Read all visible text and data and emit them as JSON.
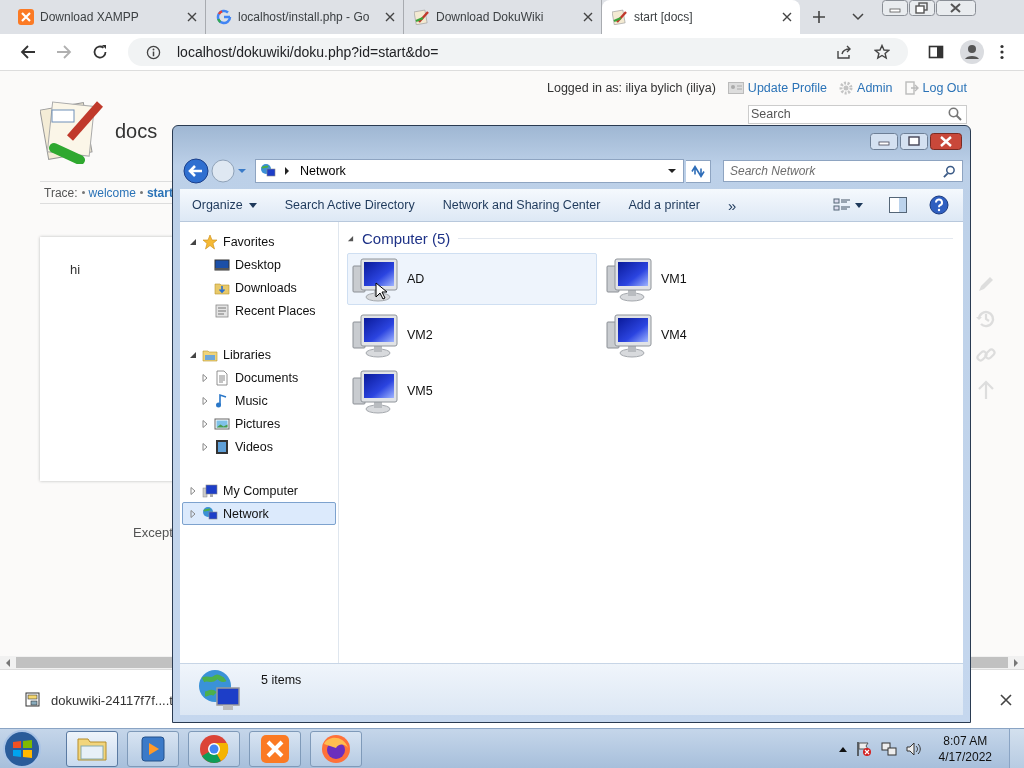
{
  "browser": {
    "tabs": [
      {
        "title": "Download XAMPP",
        "selected": false
      },
      {
        "title": "localhost/install.php - Go",
        "selected": false
      },
      {
        "title": "Download DokuWiki",
        "selected": false
      },
      {
        "title": "start [docs]",
        "selected": true
      }
    ],
    "address": "localhost/dokuwiki/doku.php?id=start&do="
  },
  "wiki": {
    "user": "Logged in as: iliya bylich (iliya)",
    "user_links": [
      "Update Profile",
      "Admin",
      "Log Out"
    ],
    "search_placeholder": "Search",
    "title": "docs",
    "trace_label": "Trace:",
    "trace": [
      "welcome",
      "start"
    ],
    "content": "hi",
    "footer": "Except"
  },
  "download": {
    "file": "dokuwiki-24117f7f....t"
  },
  "explorer": {
    "address": "Network",
    "search_placeholder": "Search Network",
    "toolbar": [
      {
        "label": "Organize",
        "menu": true
      },
      {
        "label": "Search Active Directory",
        "menu": false
      },
      {
        "label": "Network and Sharing Center",
        "menu": false
      },
      {
        "label": "Add a printer",
        "menu": false
      }
    ],
    "more": "»",
    "nav": [
      {
        "label": "Favorites",
        "expanded": true,
        "selected": false,
        "children": [
          {
            "label": "Desktop",
            "selected": false
          },
          {
            "label": "Downloads",
            "selected": false
          },
          {
            "label": "Recent Places",
            "selected": false
          }
        ]
      },
      {
        "label": "Libraries",
        "expanded": true,
        "selected": false,
        "children": [
          {
            "label": "Documents",
            "expanded": false,
            "selected": false
          },
          {
            "label": "Music",
            "expanded": false,
            "selected": false
          },
          {
            "label": "Pictures",
            "expanded": false,
            "selected": false
          },
          {
            "label": "Videos",
            "expanded": false,
            "selected": false
          }
        ]
      },
      {
        "label": "My Computer",
        "expanded": false,
        "selected": false
      },
      {
        "label": "Network",
        "expanded": false,
        "selected": true
      }
    ],
    "group": "Computer (5)",
    "items": [
      {
        "name": "AD",
        "selected": true
      },
      {
        "name": "VM1",
        "selected": false
      },
      {
        "name": "VM2",
        "selected": false
      },
      {
        "name": "VM4",
        "selected": false
      },
      {
        "name": "VM5",
        "selected": false
      }
    ],
    "status": "5 items"
  },
  "taskbar": {
    "apps": [
      {
        "kind": "explorer",
        "selected": true
      },
      {
        "kind": "media",
        "selected": false
      },
      {
        "kind": "chrome",
        "selected": false
      },
      {
        "kind": "xampp",
        "selected": false
      },
      {
        "kind": "firefox",
        "selected": false
      }
    ],
    "time": "8:07 AM",
    "date": "4/17/2022"
  }
}
